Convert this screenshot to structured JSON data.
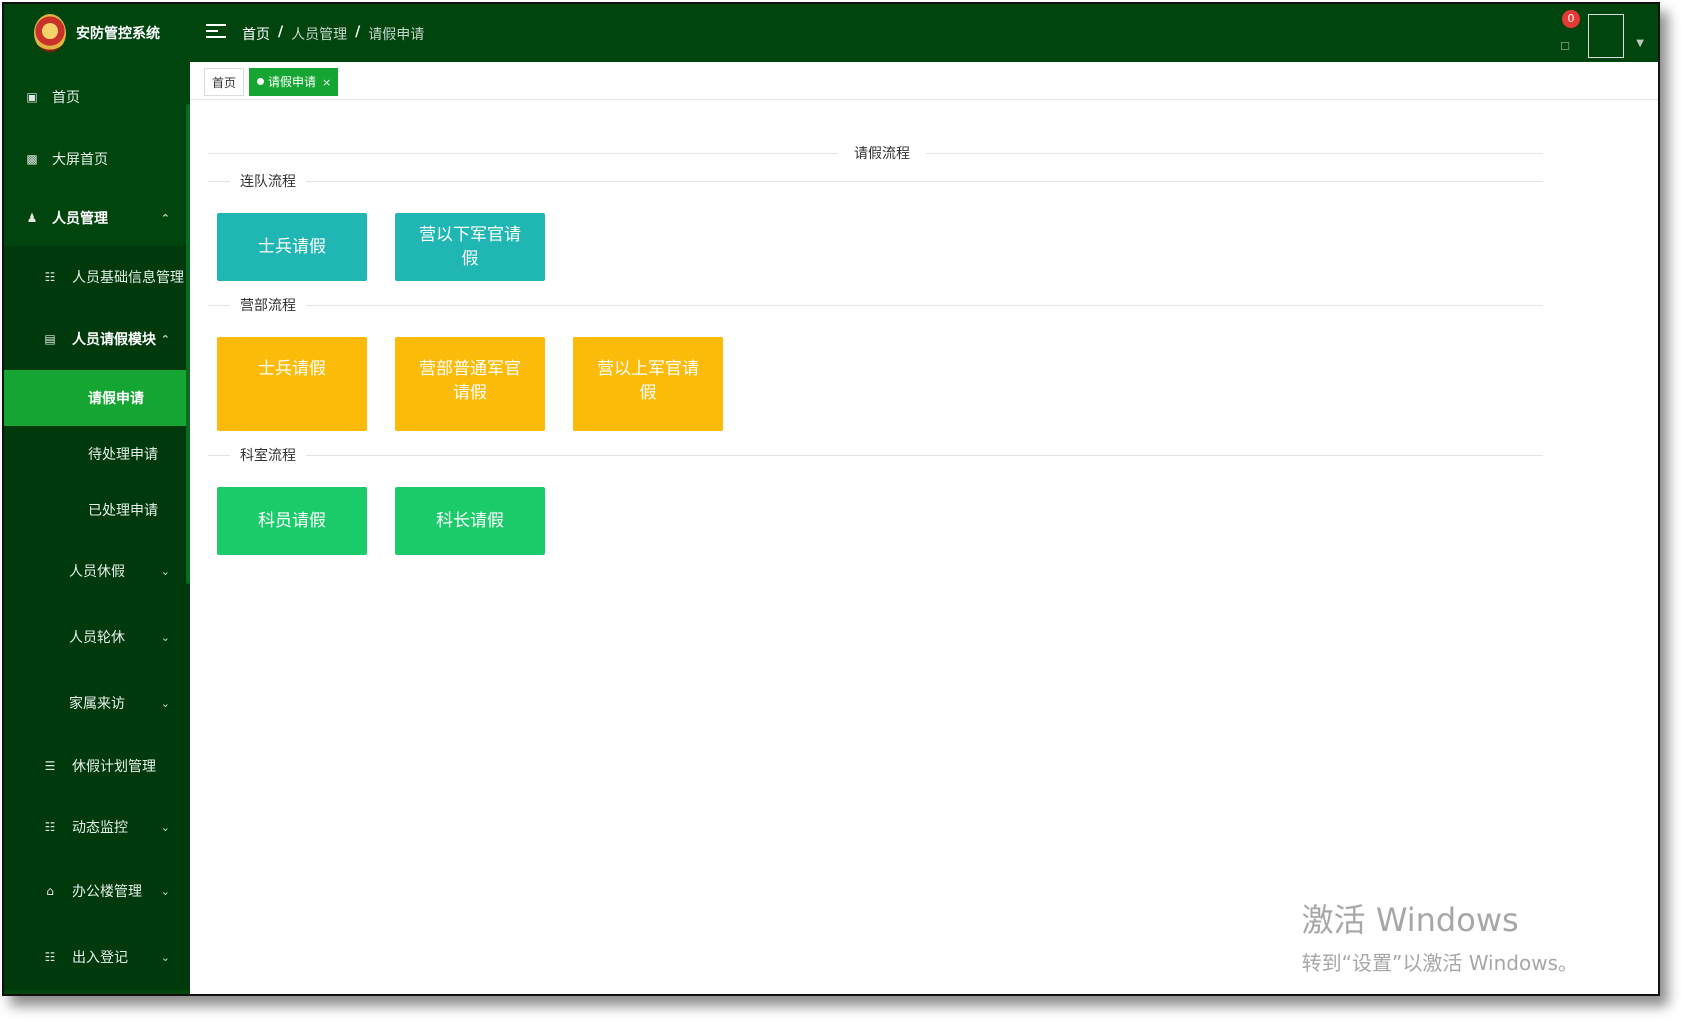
{
  "app": {
    "title": "安防管控系统"
  },
  "header": {
    "breadcrumb": [
      "首页",
      "人员管理",
      "请假申请"
    ],
    "breadcrumb_sep": "/",
    "notification_count": "0"
  },
  "sidebar": {
    "items": [
      {
        "label": "首页",
        "icon": "monitor-icon"
      },
      {
        "label": "大屏首页",
        "icon": "image-icon"
      },
      {
        "label": "人员管理",
        "icon": "user-icon"
      },
      {
        "label": "人员基础信息管理",
        "icon": "table-icon"
      },
      {
        "label": "人员请假模块",
        "icon": "document-icon"
      },
      {
        "label": "请假申请"
      },
      {
        "label": "待处理申请"
      },
      {
        "label": "已处理申请"
      },
      {
        "label": "人员休假"
      },
      {
        "label": "人员轮休"
      },
      {
        "label": "家属来访"
      },
      {
        "label": "休假计划管理",
        "icon": "list-icon"
      },
      {
        "label": "动态监控",
        "icon": "table-icon"
      },
      {
        "label": "办公楼管理",
        "icon": "home-icon"
      },
      {
        "label": "出入登记",
        "icon": "table-icon"
      }
    ]
  },
  "tabs": {
    "home": "首页",
    "active": "请假申请",
    "close": "×"
  },
  "content": {
    "title": "请假流程",
    "sections": [
      {
        "label": "连队流程",
        "buttons": [
          "士兵请假",
          "营以下军官请假"
        ]
      },
      {
        "label": "营部流程",
        "buttons": [
          "士兵请假",
          "营部普通军官请假",
          "营以上军官请假"
        ]
      },
      {
        "label": "科室流程",
        "buttons": [
          "科员请假",
          "科长请假"
        ]
      }
    ]
  },
  "watermark": {
    "line1": "激活 Windows",
    "line2": "转到“设置”以激活 Windows。"
  },
  "colors": {
    "sidebar": "#00450e",
    "active": "#14a532",
    "teal": "#1fb6b3",
    "amber": "#fdbb09",
    "green": "#1bcb6a"
  }
}
